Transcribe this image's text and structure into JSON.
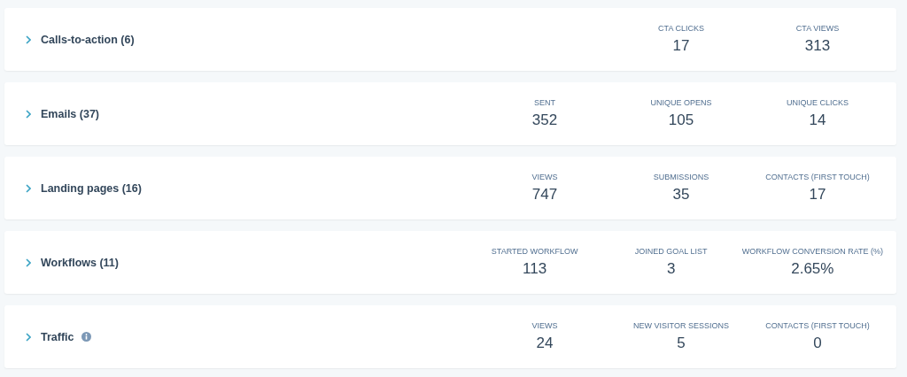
{
  "sections": [
    {
      "title": "Calls-to-action (6)",
      "expanded": false,
      "info": false,
      "stats": [
        {
          "label": "CTA CLICKS",
          "value": "17"
        },
        {
          "label": "CTA VIEWS",
          "value": "313"
        }
      ]
    },
    {
      "title": "Emails (37)",
      "expanded": false,
      "info": false,
      "stats": [
        {
          "label": "SENT",
          "value": "352"
        },
        {
          "label": "UNIQUE OPENS",
          "value": "105"
        },
        {
          "label": "UNIQUE CLICKS",
          "value": "14"
        }
      ]
    },
    {
      "title": "Landing pages (16)",
      "expanded": false,
      "info": false,
      "stats": [
        {
          "label": "VIEWS",
          "value": "747"
        },
        {
          "label": "SUBMISSIONS",
          "value": "35"
        },
        {
          "label": "CONTACTS (FIRST TOUCH)",
          "value": "17"
        }
      ]
    },
    {
      "title": "Workflows (11)",
      "expanded": false,
      "info": false,
      "stats": [
        {
          "label": "STARTED WORKFLOW",
          "value": "113"
        },
        {
          "label": "JOINED GOAL LIST",
          "value": "3"
        },
        {
          "label": "WORKFLOW CONVERSION RATE (%)",
          "value": "2.65%"
        }
      ]
    },
    {
      "title": "Traffic",
      "expanded": false,
      "info": true,
      "stats": [
        {
          "label": "VIEWS",
          "value": "24"
        },
        {
          "label": "NEW VISITOR SESSIONS",
          "value": "5"
        },
        {
          "label": "CONTACTS (FIRST TOUCH)",
          "value": "0"
        }
      ]
    }
  ]
}
